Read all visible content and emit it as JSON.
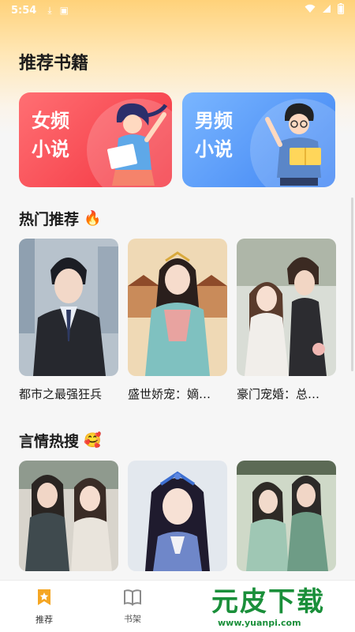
{
  "status_bar": {
    "time": "5:54",
    "icons": [
      "download-icon",
      "notification-icon",
      "wifi-icon",
      "signal-icon",
      "battery-icon"
    ]
  },
  "main": {
    "recommend_title": "推荐书籍",
    "categories": [
      {
        "label_line1": "女频",
        "label_line2": "小说",
        "color": "#f3333f"
      },
      {
        "label_line1": "男频",
        "label_line2": "小说",
        "color": "#3f84f3"
      }
    ],
    "hot_section": {
      "title": "热门推荐",
      "emoji": "🔥",
      "books": [
        {
          "title": "都市之最强狂兵"
        },
        {
          "title": "盛世娇宠：嫡…"
        },
        {
          "title": "豪门宠婚：总…"
        }
      ]
    },
    "romance_section": {
      "title": "言情热搜",
      "emoji": "🥰",
      "books": [
        {
          "title": ""
        },
        {
          "title": ""
        },
        {
          "title": ""
        }
      ]
    }
  },
  "bottom_nav": {
    "items": [
      {
        "label": "推荐",
        "icon": "star-bookmark-icon",
        "active": true
      },
      {
        "label": "书架",
        "icon": "open-book-icon",
        "active": false
      }
    ]
  },
  "watermark": {
    "text": "元皮下载",
    "url": "www.yuanpi.com"
  },
  "colors": {
    "accent": "#ffb02e",
    "female": "#f3333f",
    "male": "#3f84f3",
    "watermark": "#1a8f3a"
  }
}
